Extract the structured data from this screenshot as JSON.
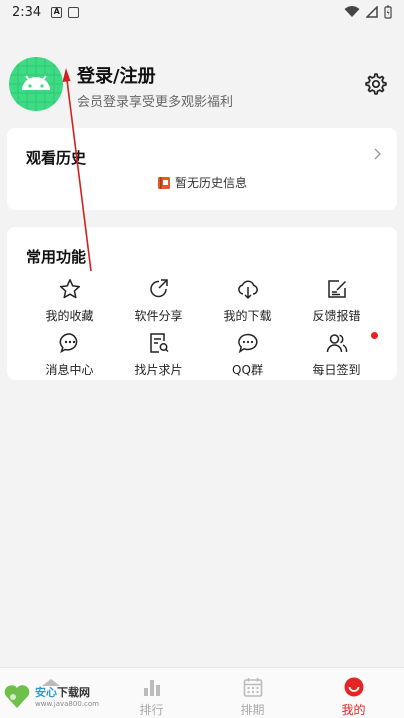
{
  "status_bar": {
    "time": "2:34",
    "icon_a": "A",
    "icon_b": "▭"
  },
  "profile": {
    "name": "登录/注册",
    "subtitle": "会员登录享受更多观影福利"
  },
  "history": {
    "title": "观看历史",
    "empty_text": "暂无历史信息"
  },
  "functions": {
    "title": "常用功能",
    "items": [
      {
        "label": "我的收藏",
        "icon": "star-icon"
      },
      {
        "label": "软件分享",
        "icon": "share-icon"
      },
      {
        "label": "我的下载",
        "icon": "cloud-download-icon"
      },
      {
        "label": "反馈报错",
        "icon": "feedback-edit-icon"
      },
      {
        "label": "消息中心",
        "icon": "message-icon"
      },
      {
        "label": "找片求片",
        "icon": "search-doc-icon"
      },
      {
        "label": "QQ群",
        "icon": "chat-bubble-icon"
      },
      {
        "label": "每日签到",
        "icon": "users-icon"
      }
    ]
  },
  "bottom_nav": {
    "items": [
      {
        "label": "",
        "icon": "home-icon"
      },
      {
        "label": "排行",
        "icon": "ranking-icon"
      },
      {
        "label": "排期",
        "icon": "calendar-icon"
      },
      {
        "label": "我的",
        "icon": "profile-icon"
      }
    ],
    "active_index": 3
  },
  "watermark": {
    "brand_a": "安心",
    "brand_b": "下载网",
    "url": "www.java800.com"
  },
  "colors": {
    "accent": "#e52525",
    "android_green": "#3ddc84",
    "arrow": "#d32020"
  }
}
